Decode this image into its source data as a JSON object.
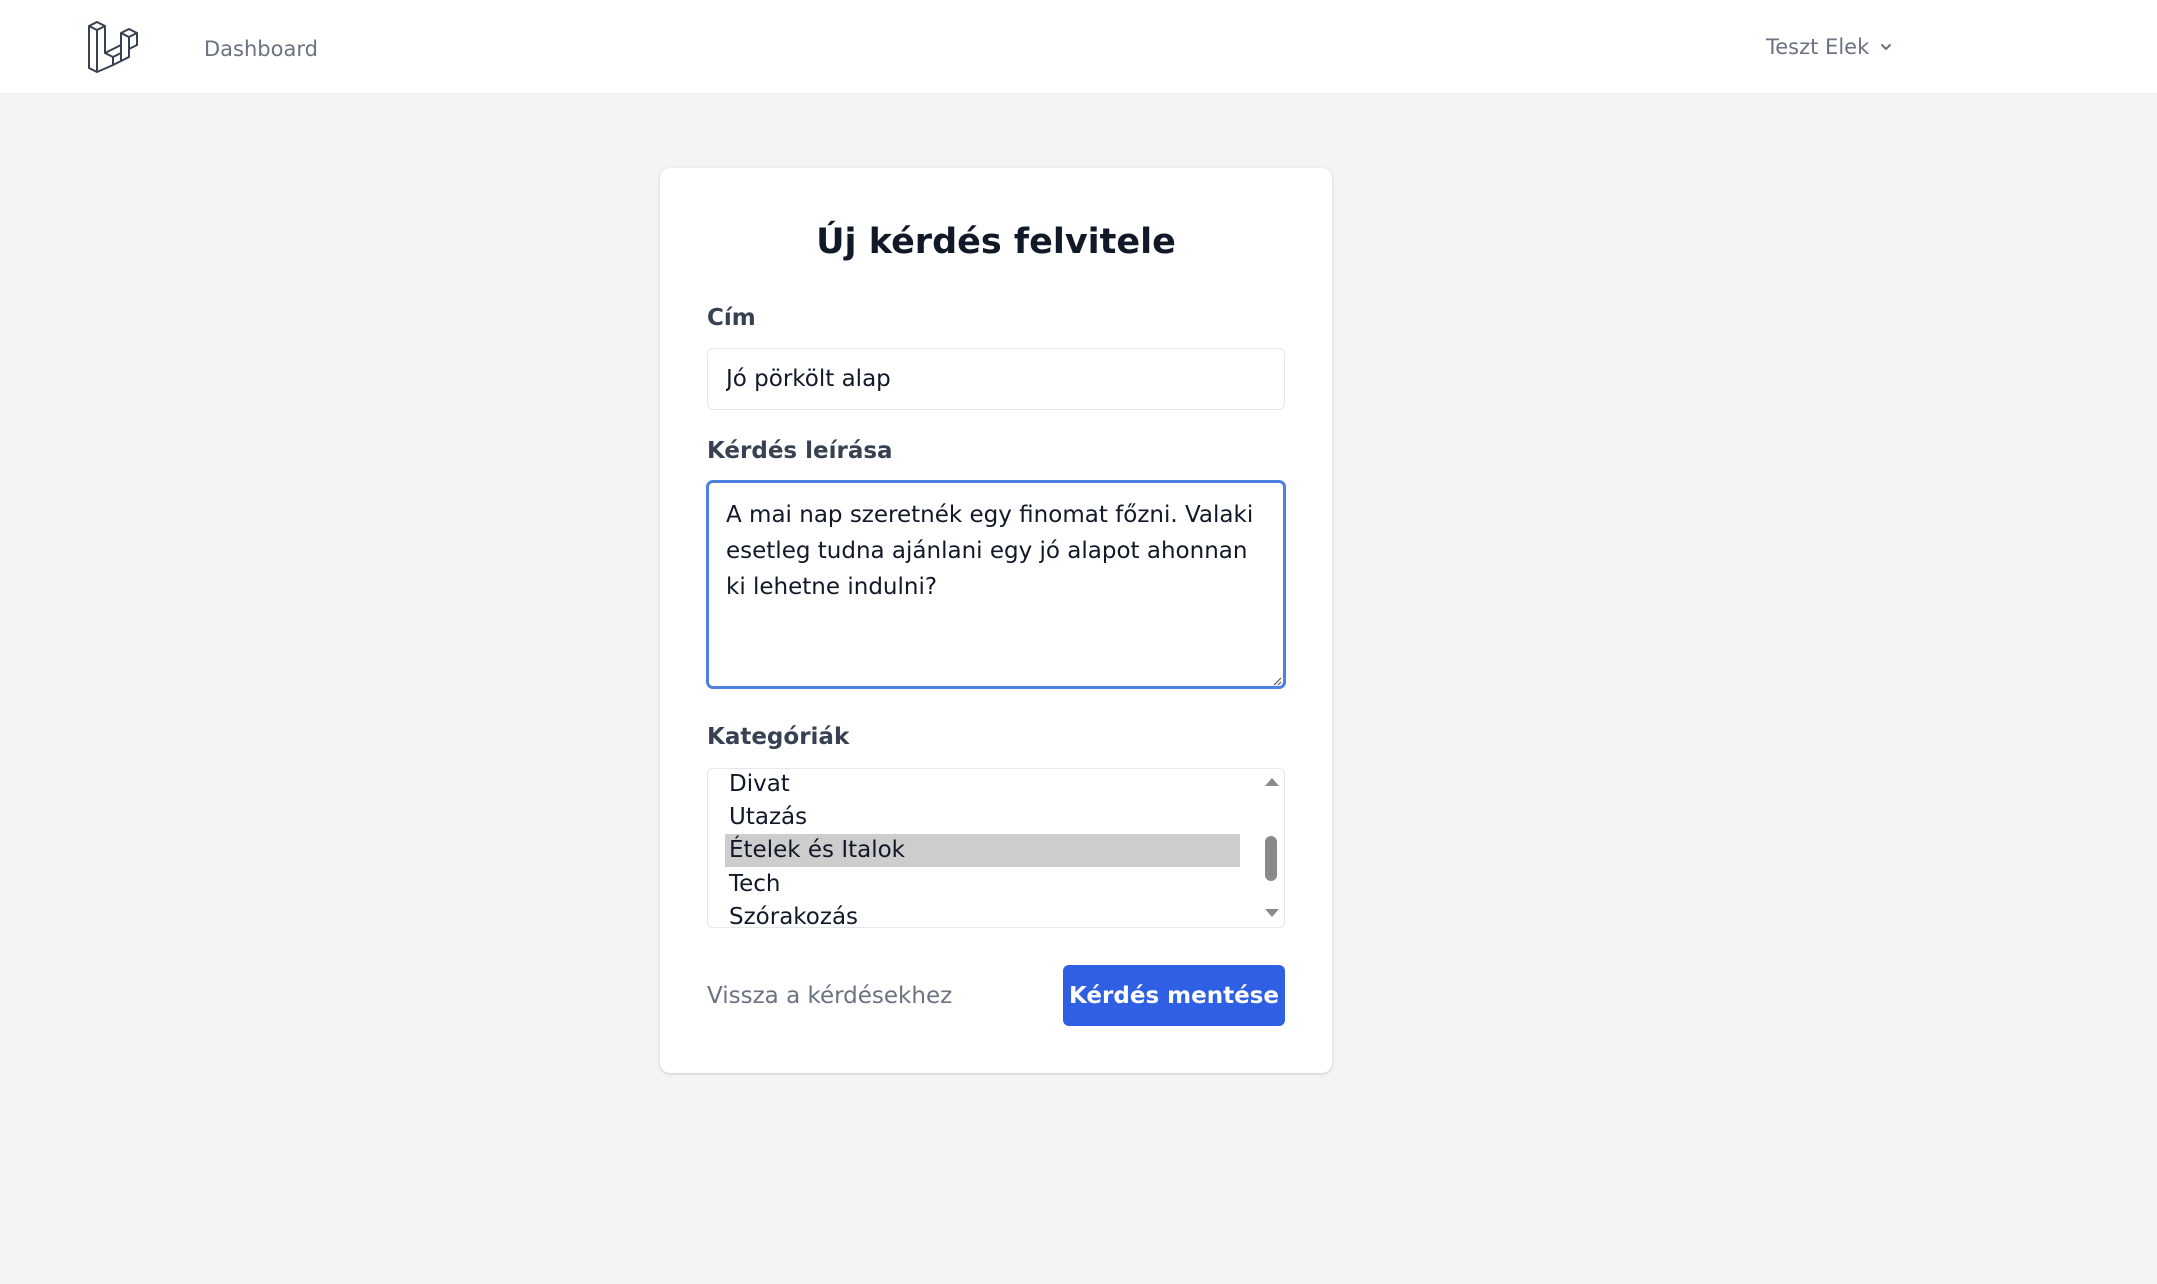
{
  "topbar": {
    "logo_icon": "laravel-logo-icon",
    "nav_dashboard": "Dashboard",
    "user_name": "Teszt Elek",
    "user_menu_icon": "chevron-down-icon"
  },
  "form": {
    "title": "Új kérdés felvitele",
    "cim_label": "Cím",
    "cim_value": "Jó pörkölt alap",
    "leiras_label": "Kérdés leírása",
    "leiras_value": "A mai nap szeretnék egy finomat főzni. Valaki esetleg tudna ajánlani egy jó alapot ahonnan ki lehetne indulni?",
    "kategoriak_label": "Kategóriák",
    "categories": [
      {
        "label": "Divat",
        "selected": false
      },
      {
        "label": "Utazás",
        "selected": false
      },
      {
        "label": "Ételek és Italok",
        "selected": true
      },
      {
        "label": "Tech",
        "selected": false
      },
      {
        "label": "Szórakozás",
        "selected": false
      }
    ],
    "back_link": "Vissza a kérdésekhez",
    "save_button": "Kérdés mentése"
  },
  "colors": {
    "page_bg": "#f3f4f6",
    "primary_button": "#2f5fe3",
    "focus_border": "#4f7fe0",
    "selected_option_bg": "#cdcdcd"
  }
}
